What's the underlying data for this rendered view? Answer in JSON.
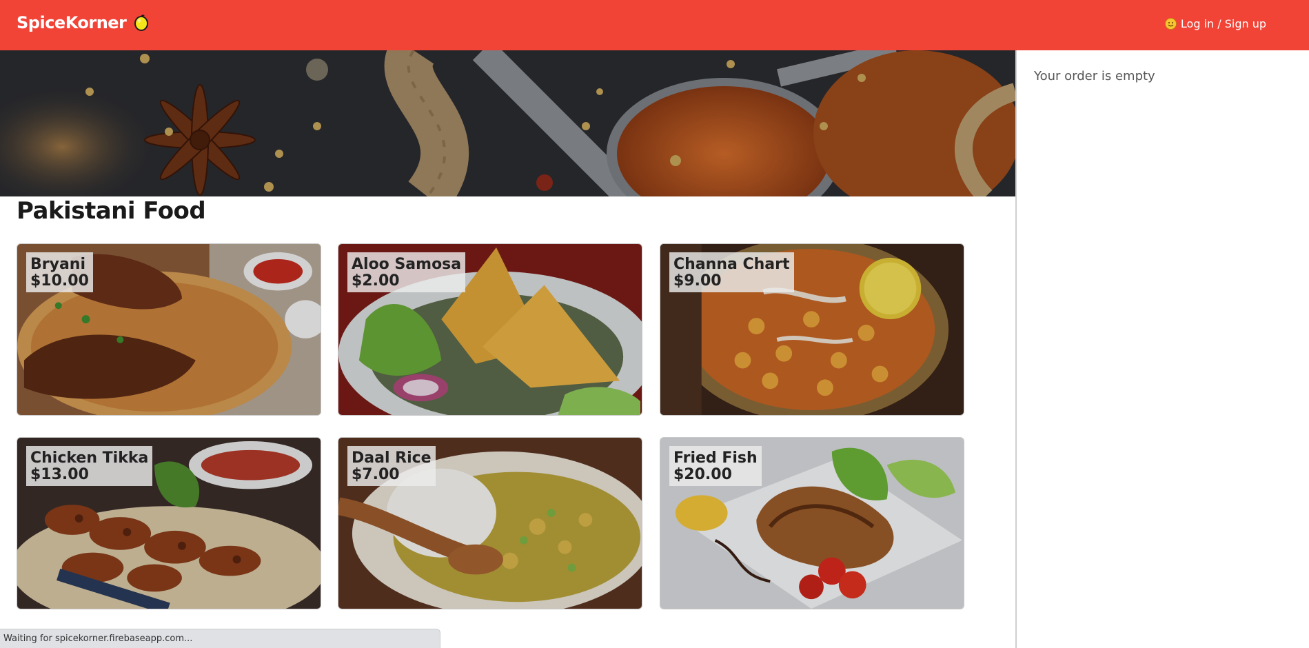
{
  "header": {
    "brand": "SpiceKorner",
    "brand_icon": "lemon-icon",
    "login_label": "Log in / Sign up",
    "login_icon": "smile-emoji-icon",
    "bg_color": "#f24337"
  },
  "order": {
    "empty_text": "Your order is empty"
  },
  "menu": {
    "section_title": "Pakistani Food",
    "items": [
      {
        "name": "Bryani",
        "price": "$10.00"
      },
      {
        "name": "Aloo Samosa",
        "price": "$2.00"
      },
      {
        "name": "Channa Chart",
        "price": "$9.00"
      },
      {
        "name": "Chicken Tikka",
        "price": "$13.00"
      },
      {
        "name": "Daal Rice",
        "price": "$7.00"
      },
      {
        "name": "Fried Fish",
        "price": "$20.00"
      }
    ]
  },
  "status": {
    "text": "Waiting for spicekorner.firebaseapp.com..."
  }
}
